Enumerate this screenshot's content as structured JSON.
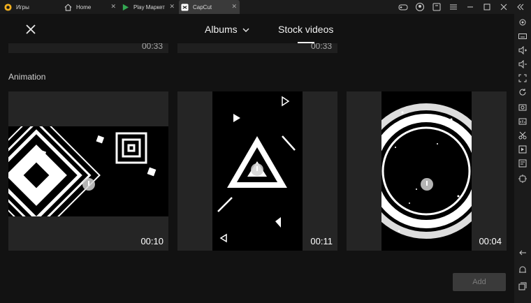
{
  "tabs": [
    {
      "label": "Игры",
      "icon": "bluestacks-logo-icon"
    },
    {
      "label": "Home",
      "icon": "home-icon"
    },
    {
      "label": "Play Маркет",
      "icon": "play-store-icon"
    },
    {
      "label": "CapCut",
      "icon": "capcut-icon"
    }
  ],
  "header": {
    "albums_label": "Albums",
    "stock_label": "Stock videos"
  },
  "previous_row": [
    {
      "duration": "00:33"
    },
    {
      "duration": "00:33"
    }
  ],
  "section": {
    "title": "Animation"
  },
  "videos": [
    {
      "duration": "00:10"
    },
    {
      "duration": "00:11"
    },
    {
      "duration": "00:04"
    }
  ],
  "add_label": "Add",
  "colors": {
    "accent": "#f0f0f0",
    "button_disabled": "#3a3a3a"
  }
}
